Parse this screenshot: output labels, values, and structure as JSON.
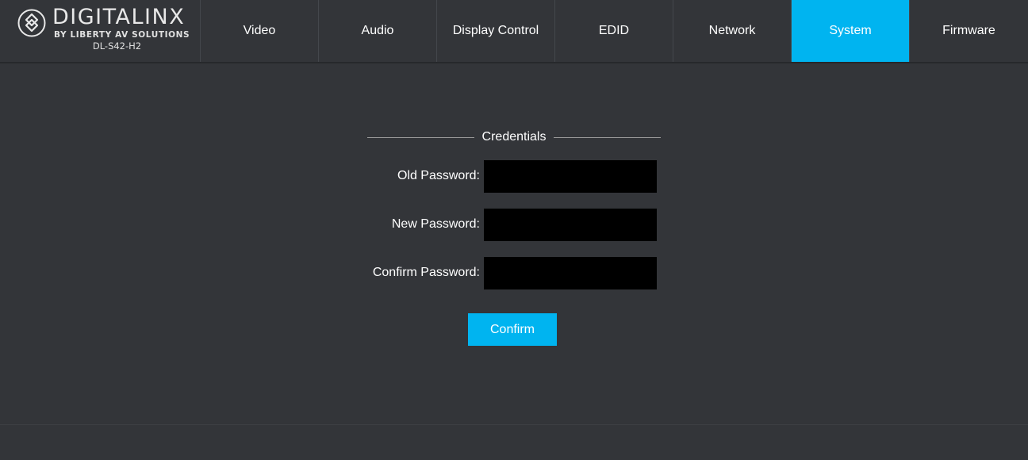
{
  "brand": {
    "wordmark": "DIGITALINX",
    "tagline": "BY LIBERTY AV SOLUTIONS",
    "model": "DL-S42-H2",
    "icon": "digitalinx-logo-icon"
  },
  "nav": {
    "tabs": [
      {
        "label": "Video",
        "active": false
      },
      {
        "label": "Audio",
        "active": false
      },
      {
        "label": "Display Control",
        "active": false
      },
      {
        "label": "EDID",
        "active": false
      },
      {
        "label": "Network",
        "active": false
      },
      {
        "label": "System",
        "active": true
      },
      {
        "label": "Firmware",
        "active": false
      }
    ]
  },
  "credentials": {
    "legend": "Credentials",
    "old_password": {
      "label": "Old Password:",
      "value": ""
    },
    "new_password": {
      "label": "New Password:",
      "value": ""
    },
    "confirm_password": {
      "label": "Confirm Password:",
      "value": ""
    },
    "confirm_button": "Confirm"
  },
  "colors": {
    "accent": "#00b4f0",
    "background": "#333539",
    "input_background": "#000000"
  }
}
